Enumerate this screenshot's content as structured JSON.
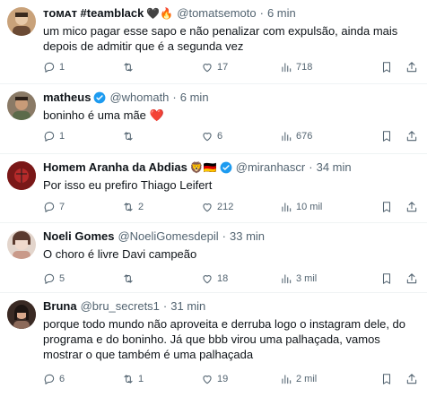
{
  "tweets": [
    {
      "name": "ᴛᴏᴍᴀᴛ #teamblack",
      "emojis": "🖤🔥",
      "verified": false,
      "handle": "@tomatsemoto",
      "time": "6 min",
      "text": "um mico pagar esse sapo e não penalizar com expulsão, ainda mais depois de admitir que é a segunda vez",
      "replies": "1",
      "retweets": "",
      "likes": "17",
      "views": "718"
    },
    {
      "name": "matheus",
      "emojis": "",
      "verified": true,
      "handle": "@whomath",
      "time": "6 min",
      "text": "boninho é uma mãe ❤️",
      "replies": "1",
      "retweets": "",
      "likes": "6",
      "views": "676"
    },
    {
      "name": "Homem Aranha da Abdias",
      "emojis": "🦁🇩🇪",
      "verified": true,
      "handle": "@miranhascr",
      "time": "34 min",
      "text": "Por isso eu prefiro Thiago Leifert",
      "replies": "7",
      "retweets": "2",
      "likes": "212",
      "views": "10 mil"
    },
    {
      "name": "Noeli Gomes",
      "emojis": "",
      "verified": false,
      "handle": "@NoeliGomesdepil",
      "time": "33 min",
      "text": "O choro é livre Davi campeão",
      "replies": "5",
      "retweets": "",
      "likes": "18",
      "views": "3 mil"
    },
    {
      "name": "Bruna",
      "emojis": "",
      "verified": false,
      "handle": "@bru_secrets1",
      "time": "31 min",
      "text": "porque todo mundo não aproveita e derruba logo o instagram dele, do programa e do boninho. Já que bbb virou uma palhaçada, vamos mostrar o que também é uma palhaçada",
      "replies": "6",
      "retweets": "1",
      "likes": "19",
      "views": "2 mil"
    }
  ],
  "dot": "·",
  "colors": {
    "text": "#0f1419",
    "secondary": "#536471",
    "verified": "#1d9bf0",
    "divider": "#eff3f4"
  }
}
